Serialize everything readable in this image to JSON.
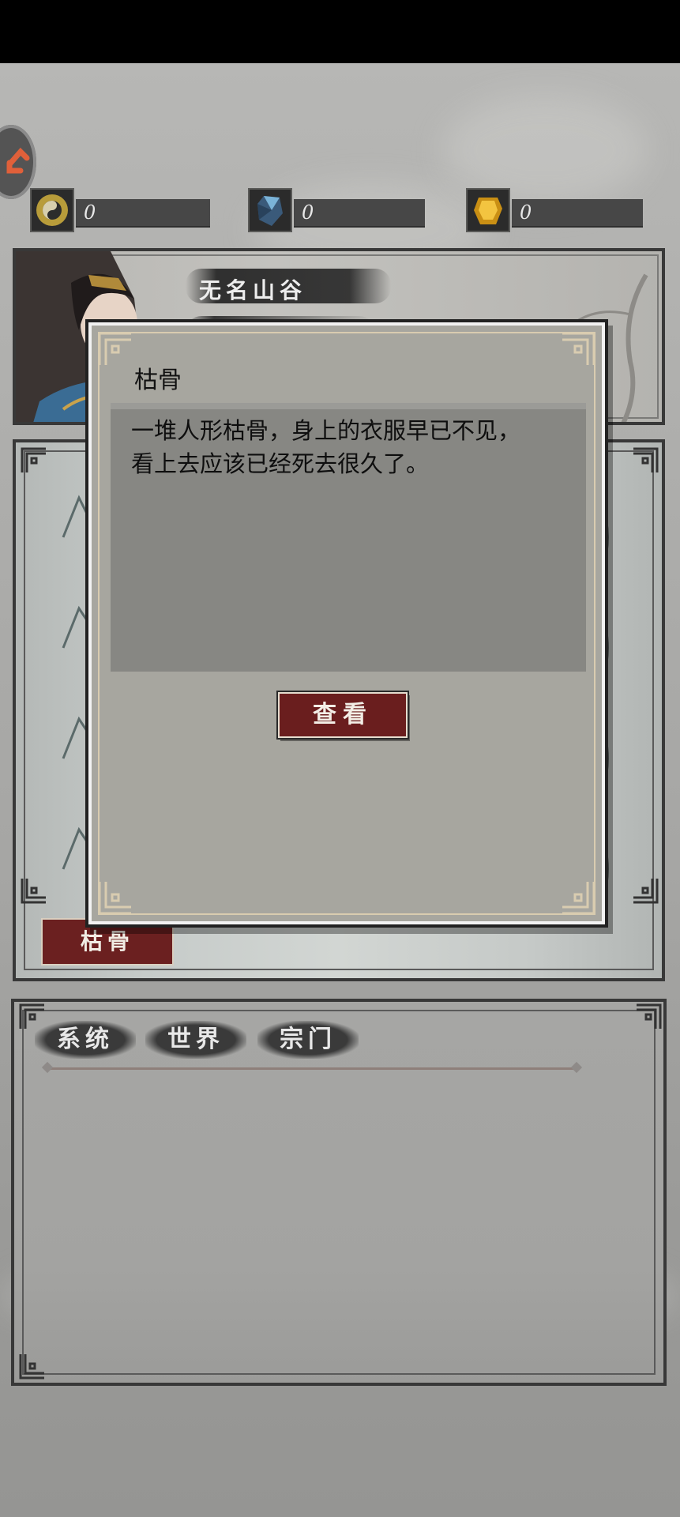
{
  "resources": [
    {
      "icon": "yin-yang-icon",
      "value": "0"
    },
    {
      "icon": "blue-crystal-icon",
      "value": "0"
    },
    {
      "icon": "gold-ingot-icon",
      "value": "0"
    }
  ],
  "location": {
    "name": "无名山谷"
  },
  "scene": {
    "object_tag": "枯骨"
  },
  "chat": {
    "tabs": [
      "系统",
      "世界",
      "宗门"
    ]
  },
  "dialog": {
    "title": "枯骨",
    "description_line1": "一堆人形枯骨，身上的衣服早已不见，",
    "description_line2": "看上去应该已经死去很久了。",
    "button": "查看"
  }
}
